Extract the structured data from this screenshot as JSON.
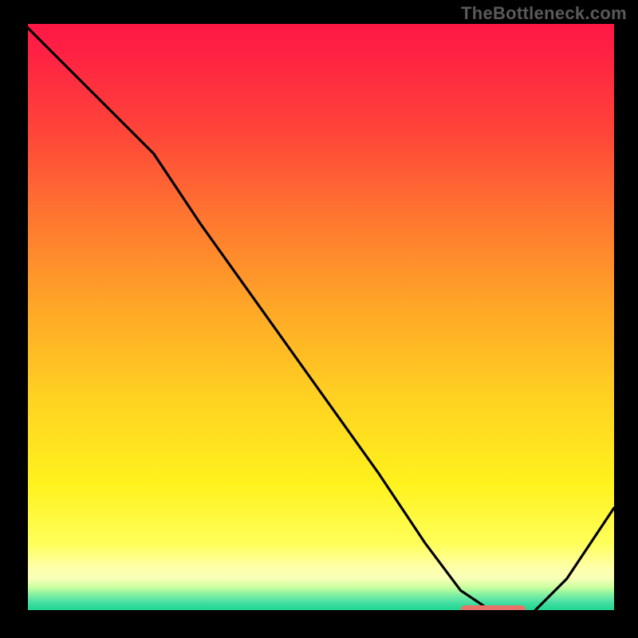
{
  "watermark": "TheBottleneck.com",
  "colors": {
    "curve": "#000000",
    "marker": "#e8736b",
    "background": "#000000"
  },
  "chart_data": {
    "type": "line",
    "title": "",
    "xlabel": "",
    "ylabel": "",
    "xlim": [
      0,
      100
    ],
    "ylim": [
      0,
      100
    ],
    "x": [
      0,
      8,
      16,
      22,
      30,
      40,
      50,
      60,
      68,
      74,
      80,
      86,
      92,
      100
    ],
    "values": [
      100,
      92,
      84,
      78,
      66,
      52,
      38,
      24,
      12,
      4,
      0,
      0,
      6,
      18
    ],
    "marker": {
      "x_start": 74,
      "x_end": 85,
      "y": 0.8
    },
    "gradient_stops": [
      {
        "pct": 0,
        "color": "#ff1745"
      },
      {
        "pct": 18,
        "color": "#ff4439"
      },
      {
        "pct": 34,
        "color": "#ff7a2f"
      },
      {
        "pct": 48,
        "color": "#ffa727"
      },
      {
        "pct": 64,
        "color": "#ffd321"
      },
      {
        "pct": 78,
        "color": "#fff21d"
      },
      {
        "pct": 92,
        "color": "#ffffa8"
      },
      {
        "pct": 96,
        "color": "#8cf3a0"
      },
      {
        "pct": 100,
        "color": "#1fd68a"
      }
    ]
  }
}
